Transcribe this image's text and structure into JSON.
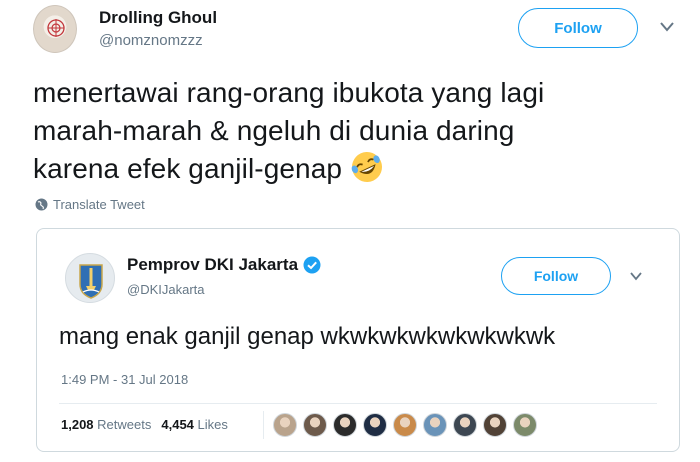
{
  "tweet": {
    "author_name": "Drolling Ghoul",
    "author_handle": "@nomznomzzz",
    "follow_label": "Follow",
    "text_lines": [
      "menertawai rang-orang ibukota yang lagi",
      "marah-marah & ngeluh di dunia daring",
      "karena efek ganjil-genap"
    ],
    "emoji": "rolling-on-the-floor-laughing-icon",
    "translate_label": "Translate Tweet"
  },
  "quoted": {
    "author_name": "Pemprov DKI Jakarta",
    "author_handle": "@DKIJakarta",
    "follow_label": "Follow",
    "text": "mang enak ganjil genap wkwkwkwkwkwkwkwk",
    "timestamp": "1:49 PM - 31 Jul 2018",
    "retweets_count": "1,208",
    "retweets_label": "Retweets",
    "likes_count": "4,454",
    "likes_label": "Likes",
    "liker_colors": [
      "#b9a38c",
      "#6d5a4b",
      "#2b2b2b",
      "#1f2d44",
      "#c98a4a",
      "#6a93b8",
      "#3d4752",
      "#514236",
      "#7c8a6a"
    ]
  },
  "colors": {
    "accent": "#1da1f2",
    "secondary_text": "#657786",
    "verified": "#1da1f2"
  }
}
